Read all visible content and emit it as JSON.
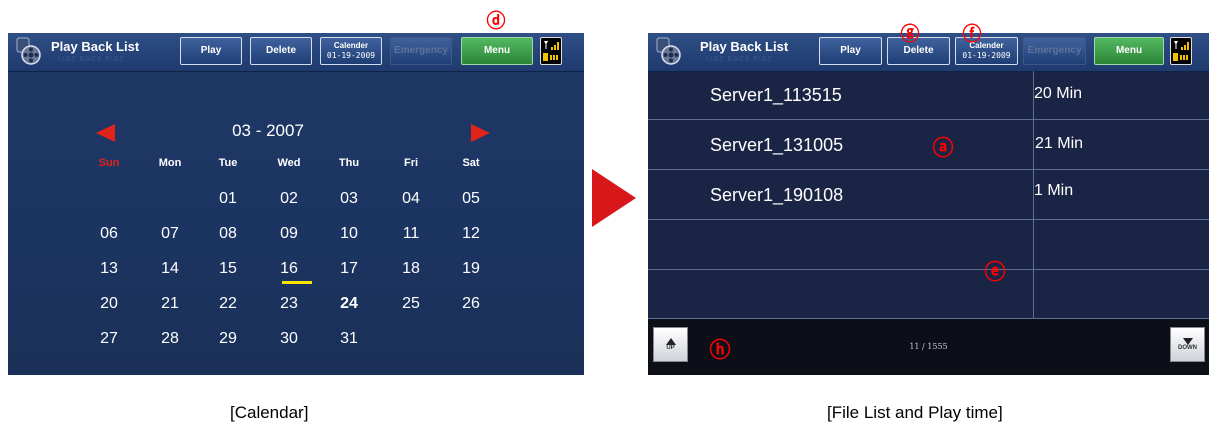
{
  "left_screen": {
    "title": "Play Back List",
    "title_shadow": "LIST BACK FIST",
    "buttons": {
      "play": "Play",
      "delete": "Delete",
      "calendar_top": "Calender",
      "calendar_date": "01-19-2009",
      "emergency": "Emergency",
      "menu": "Menu"
    },
    "month": "03 - 2007",
    "weekdays": [
      "Sun",
      "Mon",
      "Tue",
      "Wed",
      "Thu",
      "Fri",
      "Sat"
    ],
    "weeks": [
      [
        "",
        "",
        "01",
        "02",
        "03",
        "04",
        "05"
      ],
      [
        "06",
        "07",
        "08",
        "09",
        "10",
        "11",
        "12"
      ],
      [
        "13",
        "14",
        "15",
        "16",
        "17",
        "18",
        "19"
      ],
      [
        "20",
        "21",
        "22",
        "23",
        "24",
        "25",
        "26"
      ],
      [
        "27",
        "28",
        "29",
        "30",
        "31",
        "",
        ""
      ]
    ],
    "selected_day": "16",
    "today": "24"
  },
  "right_screen": {
    "title": "Play Back List",
    "title_shadow": "LIST BACK FIST",
    "buttons": {
      "play": "Play",
      "delete": "Delete",
      "calendar_top": "Calender",
      "calendar_date": "01-19-2009",
      "emergency": "Emergency",
      "menu": "Menu"
    },
    "files": [
      {
        "name": "Server1_113515",
        "time": "20 Min"
      },
      {
        "name": "Server1_131005",
        "time": "21 Min"
      },
      {
        "name": "Server1_190108",
        "time": "1 Min"
      },
      {
        "name": "",
        "time": ""
      },
      {
        "name": "",
        "time": ""
      }
    ],
    "page_indicator": "11 / 1555",
    "up_label": "UP",
    "down_label": "DOWN"
  },
  "callouts": {
    "a": "ⓐ",
    "d": "ⓓ",
    "e": "ⓔ",
    "f": "ⓕ",
    "g": "ⓖ",
    "h": "ⓗ"
  },
  "captions": {
    "left": "[Calendar]",
    "right": "[File List and Play time]"
  },
  "colors": {
    "accent_red": "#e2231a",
    "callout_red": "#ff0000",
    "screen_bg": "#1e3563",
    "highlight_yellow": "#f6e300",
    "menu_green": "#3a9e46"
  }
}
